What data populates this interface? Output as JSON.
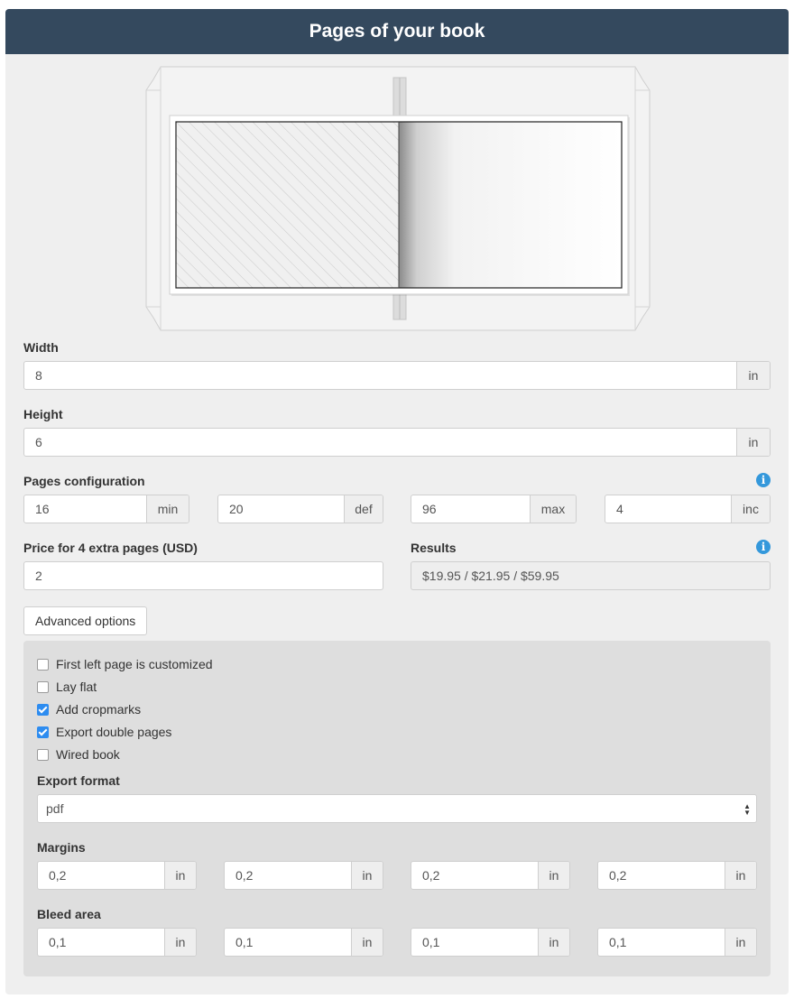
{
  "header": {
    "title": "Pages of your book"
  },
  "width": {
    "label": "Width",
    "value": "8",
    "unit": "in"
  },
  "height": {
    "label": "Height",
    "value": "6",
    "unit": "in"
  },
  "pages_config": {
    "label": "Pages configuration",
    "info_icon": "info-icon",
    "fields": [
      {
        "value": "16",
        "unit": "min"
      },
      {
        "value": "20",
        "unit": "def"
      },
      {
        "value": "96",
        "unit": "max"
      },
      {
        "value": "4",
        "unit": "inc"
      }
    ]
  },
  "price": {
    "label": "Price for 4 extra pages (USD)",
    "value": "2"
  },
  "results": {
    "label": "Results",
    "value": "$19.95 / $21.95 / $59.95",
    "info_icon": "info-icon"
  },
  "advanced_button": "Advanced options",
  "advanced": {
    "checkboxes": [
      {
        "label": "First left page is customized",
        "checked": false
      },
      {
        "label": "Lay flat",
        "checked": false
      },
      {
        "label": "Add cropmarks",
        "checked": true
      },
      {
        "label": "Export double pages",
        "checked": true
      },
      {
        "label": "Wired book",
        "checked": false
      }
    ],
    "export_format": {
      "label": "Export format",
      "value": "pdf"
    },
    "margins": {
      "label": "Margins",
      "fields": [
        {
          "value": "0,2",
          "unit": "in"
        },
        {
          "value": "0,2",
          "unit": "in"
        },
        {
          "value": "0,2",
          "unit": "in"
        },
        {
          "value": "0,2",
          "unit": "in"
        }
      ]
    },
    "bleed": {
      "label": "Bleed area",
      "fields": [
        {
          "value": "0,1",
          "unit": "in"
        },
        {
          "value": "0,1",
          "unit": "in"
        },
        {
          "value": "0,1",
          "unit": "in"
        },
        {
          "value": "0,1",
          "unit": "in"
        }
      ]
    }
  },
  "colors": {
    "header_bg": "#34495e",
    "checkbox_checked": "#2d8cf0",
    "info_icon": "#3498db"
  }
}
